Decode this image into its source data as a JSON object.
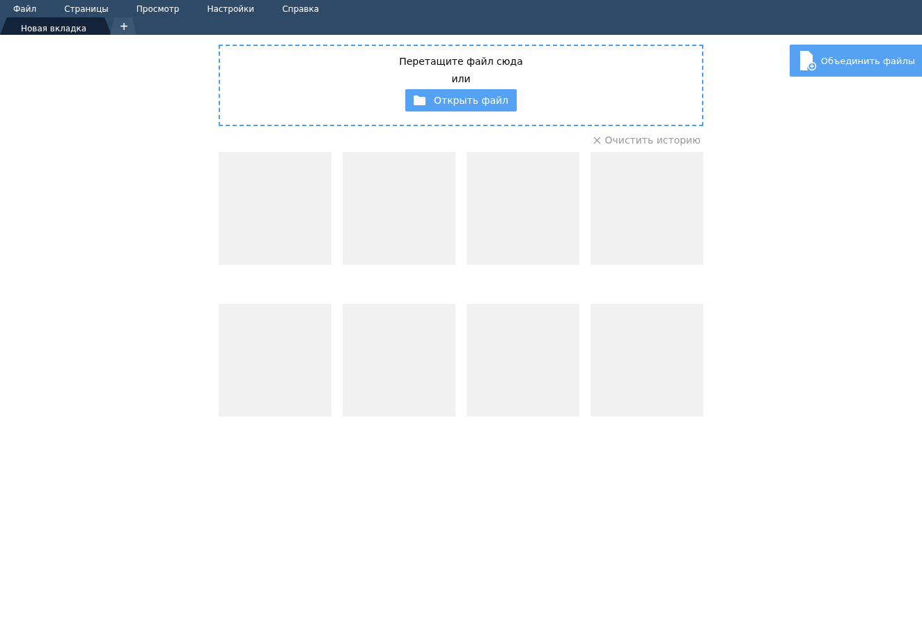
{
  "menu": [
    "Файл",
    "Страницы",
    "Просмотр",
    "Настройки",
    "Справка"
  ],
  "tabs": [
    {
      "label": "Новая вкладка",
      "selected": true
    }
  ],
  "new_tab_button": "+",
  "dropzone": {
    "prompt": "Перетащите файл сюда",
    "separator": "или",
    "open_button": "Открыть файл"
  },
  "clear_history": "Очистить историю",
  "history": [
    {
      "kind": "placeholder"
    },
    {
      "kind": "placeholder"
    },
    {
      "kind": "placeholder"
    },
    {
      "kind": "placeholder"
    },
    {
      "kind": "placeholder"
    },
    {
      "kind": "placeholder"
    },
    {
      "kind": "placeholder"
    },
    {
      "kind": "placeholder"
    }
  ],
  "merge_button": "Объединить файлы"
}
